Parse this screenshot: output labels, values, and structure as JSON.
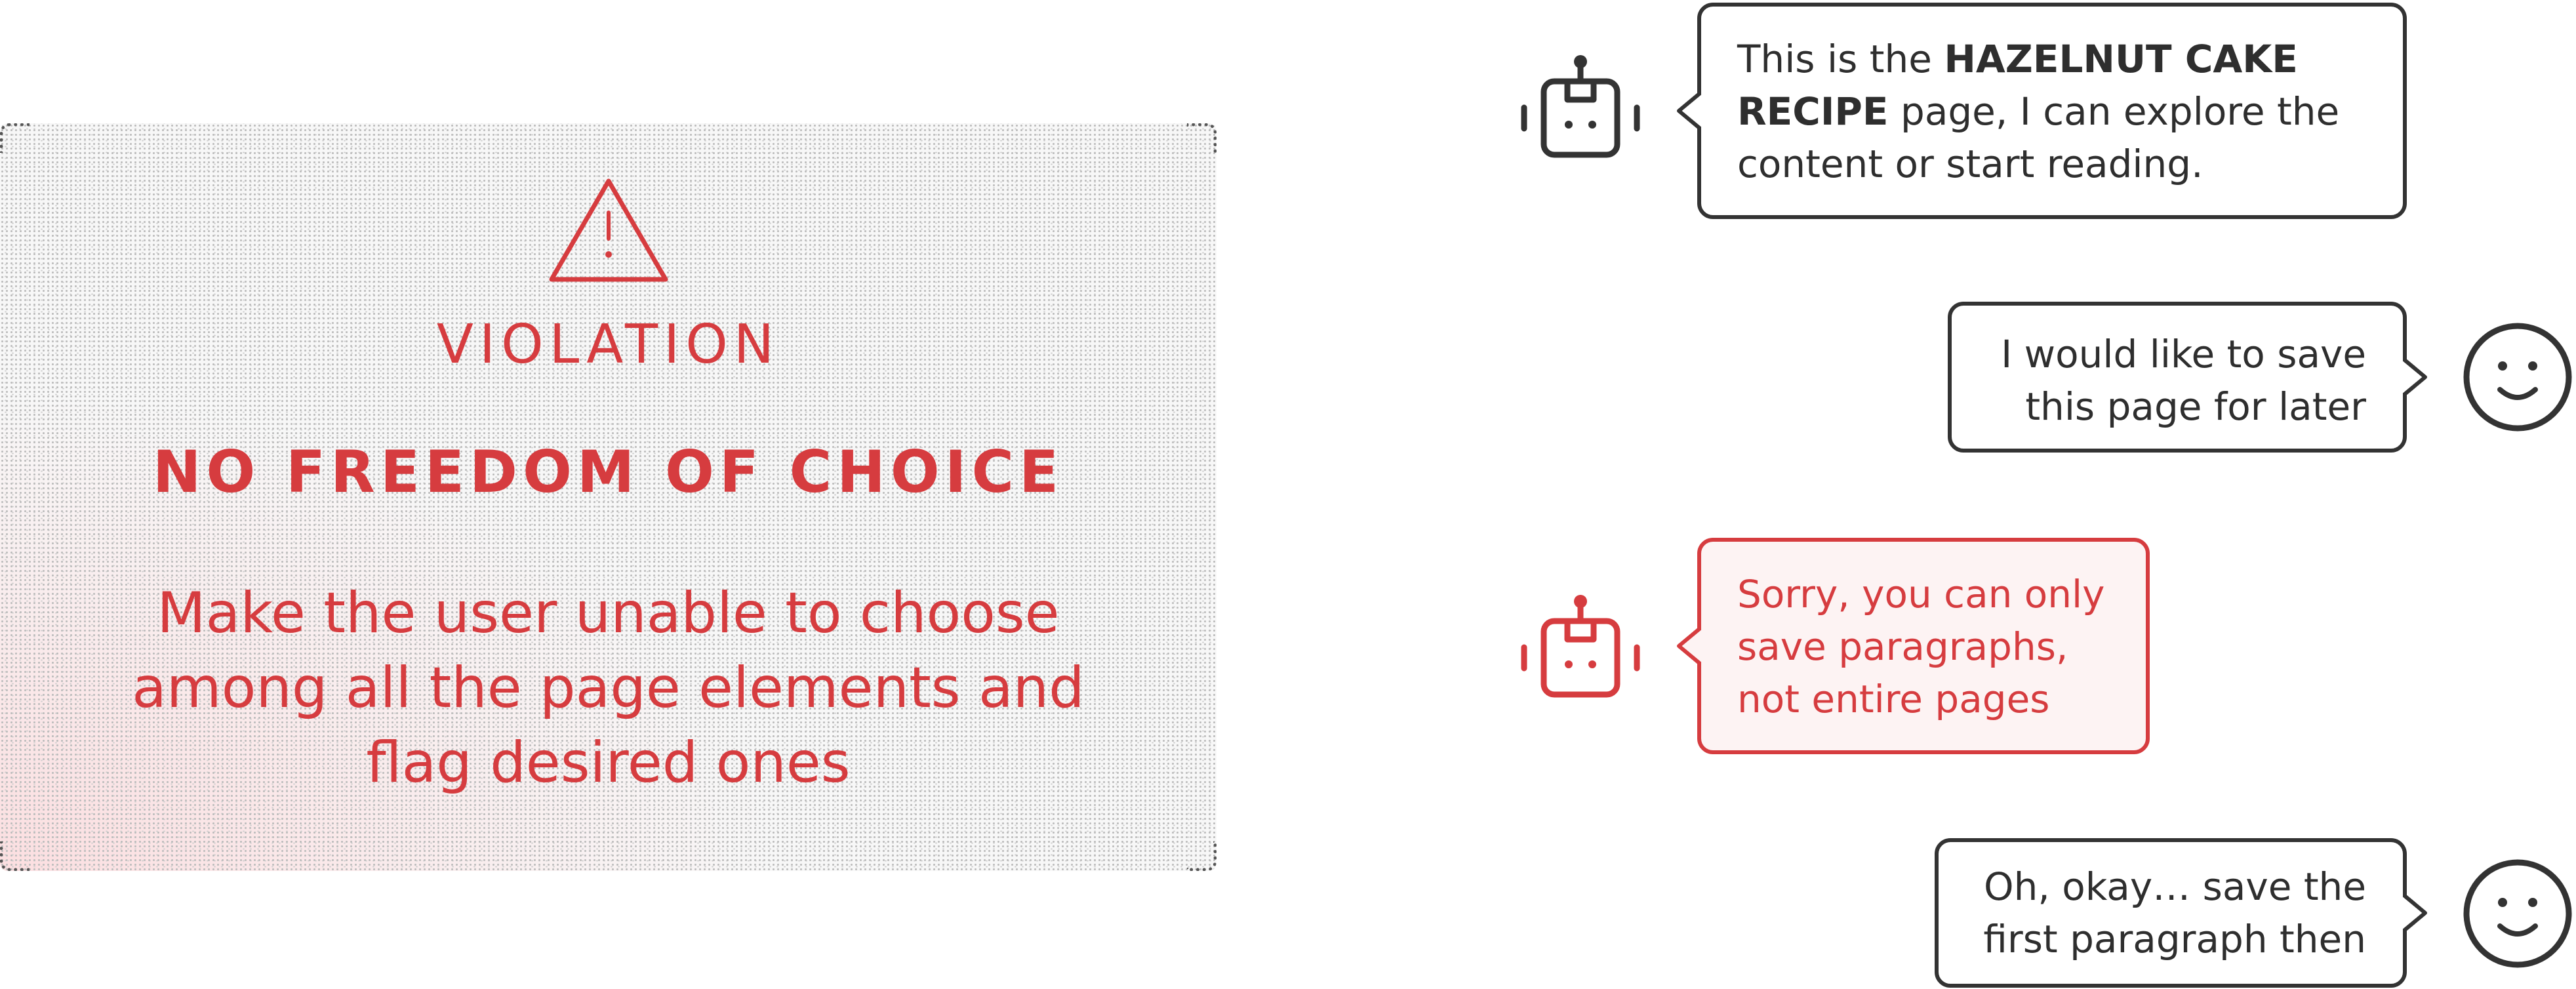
{
  "violation": {
    "label": "VIOLATION",
    "title": "NO FREEDOM OF CHOICE",
    "description": "Make the user unable to choose among all the page elements and flag desired ones",
    "icon": "warning-icon",
    "accent_color": "#d63c3f"
  },
  "chat": {
    "messages": [
      {
        "speaker": "bot",
        "icon": "robot-icon",
        "text_before": "This is the ",
        "text_bold": "HAZELNUT CAKE RECIPE",
        "text_after": " page, I can explore the content or start reading."
      },
      {
        "speaker": "user",
        "icon": "smiley-icon",
        "text": "I would like to save this page for later"
      },
      {
        "speaker": "bot",
        "icon": "robot-icon",
        "text": "Sorry, you can only save paragraphs, not entire pages",
        "status_color": "#d63c3f"
      },
      {
        "speaker": "user",
        "icon": "smiley-icon",
        "text": "Oh, okay… save the first paragraph then"
      }
    ]
  }
}
